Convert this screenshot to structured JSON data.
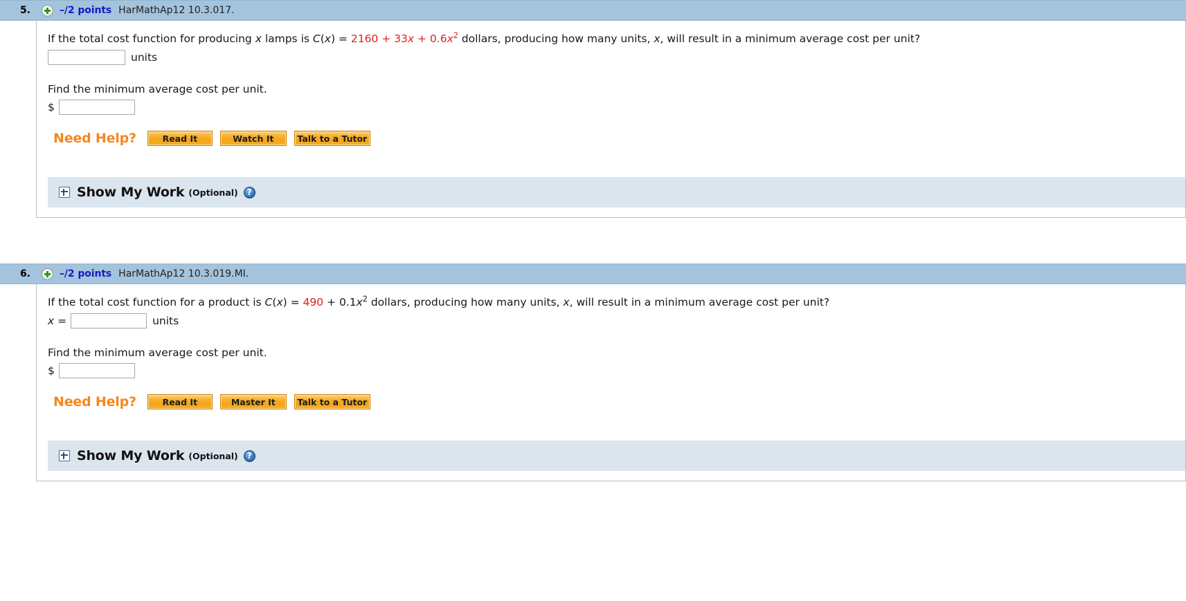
{
  "colors": {
    "header_bar": "#a4c3dc",
    "points_text": "#1818c8",
    "red_term": "#e02020",
    "need_help": "#f5871f",
    "button_orange": "#f4a516",
    "show_my_work_bar": "#dbe5ee"
  },
  "problems": [
    {
      "number": "5.",
      "points": "–/2 points",
      "reference": "HarMathAp12 10.3.017.",
      "plus_icon": "plus-circle-icon",
      "question": {
        "part1": "If the total cost function for producing ",
        "var1": "x",
        "part2": " lamps is ",
        "fn": "C",
        "fn_open": "(",
        "fn_var": "x",
        "fn_close": ") = ",
        "term1": "2160",
        "plus1": " + ",
        "term2": "33",
        "term2_var": "x",
        "plus2": " + ",
        "term3": "0.6",
        "term3_var": "x",
        "term3_sup": "2",
        "part3": " dollars, producing how many units, ",
        "var2": "x",
        "part4": ", will result in a minimum average cost per unit?"
      },
      "answer1": {
        "prefix": "",
        "value": "",
        "placeholder": "",
        "suffix": "units"
      },
      "find_line": "Find the minimum average cost per unit.",
      "answer2": {
        "prefix": "$",
        "value": "",
        "placeholder": "",
        "suffix": ""
      },
      "need_help_label": "Need Help?",
      "help_buttons": [
        "Read It",
        "Watch It",
        "Talk to a Tutor"
      ],
      "show_my_work": {
        "title": "Show My Work",
        "optional": "(Optional)",
        "help_glyph": "?",
        "toggle_icon": "expand-plus-icon"
      }
    },
    {
      "number": "6.",
      "points": "–/2 points",
      "reference": "HarMathAp12 10.3.019.MI.",
      "plus_icon": "plus-circle-icon",
      "question": {
        "part1": "If the total cost function for a product is ",
        "var1": "",
        "part2": "",
        "fn": "C",
        "fn_open": "(",
        "fn_var": "x",
        "fn_close": ") = ",
        "term1": "490",
        "plus1": " + ",
        "term2": "",
        "term2_var": "",
        "plus2": "",
        "term3": "0.1",
        "term3_var": "x",
        "term3_sup": "2",
        "part3": " dollars, producing how many units, ",
        "var2": "x",
        "part4": ", will result in a minimum average cost per unit?"
      },
      "answer1": {
        "prefix": "x =",
        "value": "",
        "placeholder": "",
        "suffix": "units"
      },
      "find_line": "Find the minimum average cost per unit.",
      "answer2": {
        "prefix": "$",
        "value": "",
        "placeholder": "",
        "suffix": ""
      },
      "need_help_label": "Need Help?",
      "help_buttons": [
        "Read It",
        "Master It",
        "Talk to a Tutor"
      ],
      "show_my_work": {
        "title": "Show My Work",
        "optional": "(Optional)",
        "help_glyph": "?",
        "toggle_icon": "expand-plus-icon"
      }
    }
  ]
}
